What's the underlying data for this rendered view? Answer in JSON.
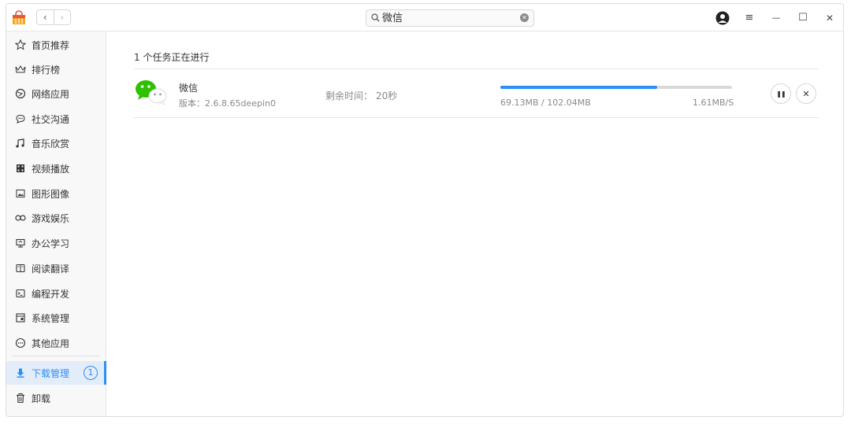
{
  "header": {
    "nav_back": "‹",
    "nav_forward": "›",
    "search": {
      "value": "微信",
      "placeholder": ""
    },
    "menu_glyph": "≡",
    "minimize_glyph": "—",
    "maximize_glyph": "☐",
    "close_glyph": "✕"
  },
  "sidebar": {
    "items": [
      {
        "label": "首页推荐",
        "icon": "star-icon"
      },
      {
        "label": "排行榜",
        "icon": "crown-icon"
      },
      {
        "label": "网络应用",
        "icon": "globe-icon"
      },
      {
        "label": "社交沟通",
        "icon": "chat-icon"
      },
      {
        "label": "音乐欣赏",
        "icon": "music-icon"
      },
      {
        "label": "视频播放",
        "icon": "film-icon"
      },
      {
        "label": "图形图像",
        "icon": "image-icon"
      },
      {
        "label": "游戏娱乐",
        "icon": "gamepad-icon"
      },
      {
        "label": "办公学习",
        "icon": "briefcase-icon"
      },
      {
        "label": "阅读翻译",
        "icon": "book-icon"
      },
      {
        "label": "编程开发",
        "icon": "terminal-icon"
      },
      {
        "label": "系统管理",
        "icon": "system-icon"
      },
      {
        "label": "其他应用",
        "icon": "more-icon"
      }
    ],
    "download": {
      "label": "下载管理",
      "badge": "1",
      "icon": "download-icon"
    },
    "uninstall": {
      "label": "卸载",
      "icon": "trash-icon"
    }
  },
  "main": {
    "task_count": "1 个任务正在进行",
    "task": {
      "name": "微信",
      "version": "版本：2.6.8.65deepin0",
      "remain_label": "剩余时间：",
      "remain_value": "20秒",
      "progress_fraction": 0.677,
      "size": "69.13MB / 102.04MB",
      "speed": "1.61MB/S",
      "pause_glyph": "❚❚",
      "cancel_glyph": "✕"
    }
  },
  "colors": {
    "accent": "#2c8ef8",
    "wechat_green": "#2dc100"
  }
}
